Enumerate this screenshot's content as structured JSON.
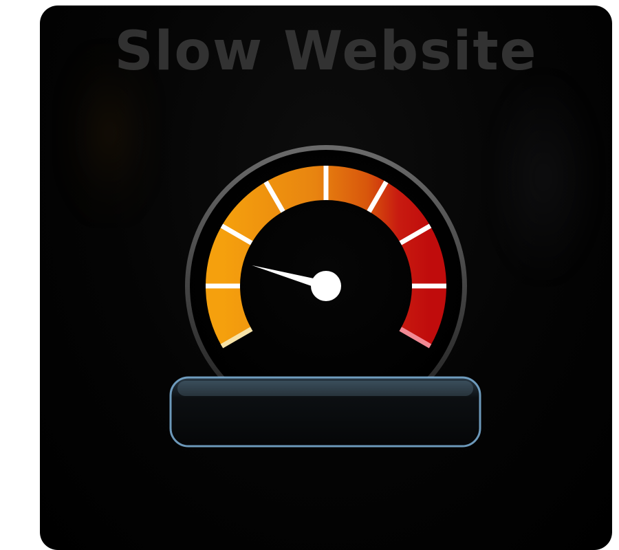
{
  "headline": "Slow Website",
  "gauge": {
    "level": 0.19,
    "tick_count": 9,
    "colors": {
      "low": "#f29b0c",
      "mid": "#e07a10",
      "high": "#c41010",
      "tick": "#ffffff",
      "needle": "#ffffff",
      "bezel": "#5a5a5a",
      "base_edge": "#7fb3d9"
    }
  }
}
